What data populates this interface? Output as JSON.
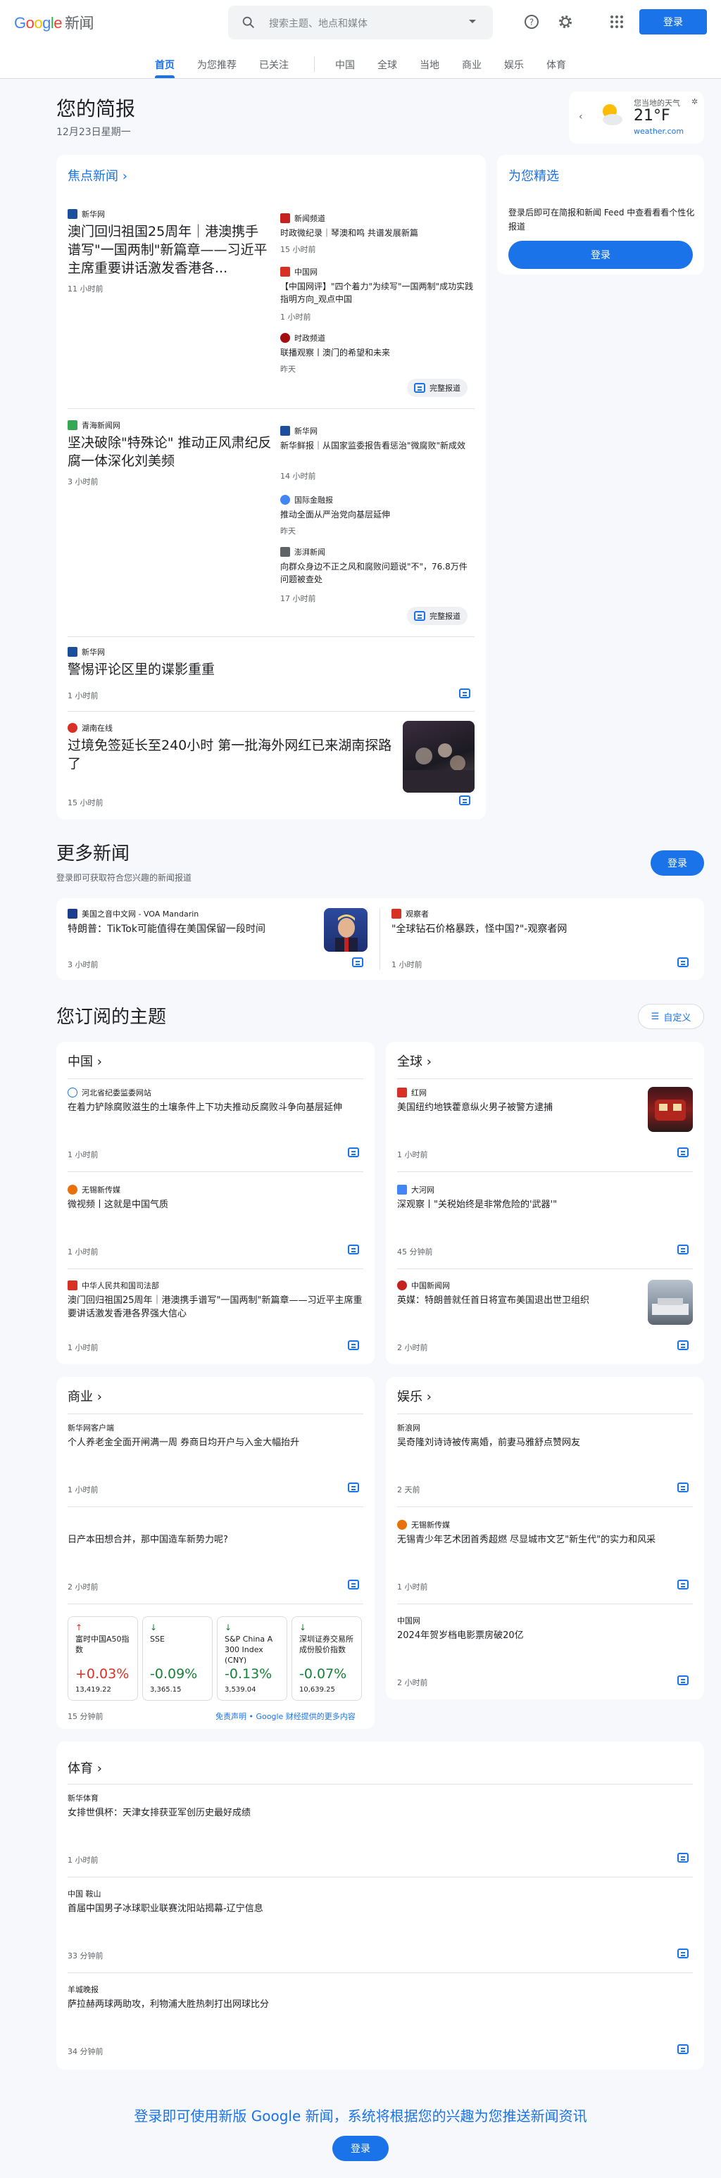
{
  "header": {
    "logo_google": "Google",
    "logo_news": "新闻",
    "search_placeholder": "搜索主题、地点和媒体",
    "signin": "登录"
  },
  "nav": [
    "首页",
    "为您推荐",
    "已关注",
    "中国",
    "全球",
    "当地",
    "商业",
    "娱乐",
    "体育"
  ],
  "briefing": {
    "title": "您的简报",
    "date": "12月23日星期一"
  },
  "weather": {
    "label": "您当地的天气",
    "temp": "21°F",
    "source": "weather.com"
  },
  "picks": {
    "title": "为您精选",
    "desc": "登录后即可在简报和新闻 Feed 中查看看看个性化报道",
    "button": "登录"
  },
  "top": {
    "title": "焦点新闻",
    "c1": {
      "source": "新华网",
      "headline": "澳门回归祖国25周年｜港澳携手谱写\"一国两制\"新篇章——习近平主席重要讲话激发香港各...",
      "time": "11 小时前",
      "side": [
        {
          "source": "新闻频道",
          "headline": "时政微纪录｜琴澳和鸣 共谱发展新篇",
          "time": "15 小时前"
        },
        {
          "source": "中国网",
          "headline": "【中国网评】\"四个着力\"为续写\"一国两制\"成功实践指明方向_观点中国",
          "time": "1 小时前"
        },
        {
          "source": "时政频道",
          "headline": "联播观察丨澳门的希望和未来",
          "time": "昨天"
        }
      ],
      "full": "完整报道"
    },
    "c2": {
      "source": "青海新闻网",
      "headline": "坚决破除\"特殊论\" 推动正风肃纪反腐一体深化刘美频",
      "time": "3 小时前",
      "side": [
        {
          "source": "新华网",
          "headline": "新华鲜报｜从国家监委报告看惩治\"微腐败\"新成效",
          "time": "14 小时前"
        },
        {
          "source": "国际金融报",
          "headline": "推动全面从严治党向基层延伸",
          "time": "昨天"
        },
        {
          "source": "澎湃新闻",
          "headline": "向群众身边不正之风和腐败问题说\"不\"，76.8万件问题被查处",
          "time": "17 小时前"
        }
      ],
      "full": "完整报道"
    },
    "s3": {
      "source": "新华网",
      "headline": "警惕评论区里的谍影重重",
      "time": "1 小时前"
    },
    "s4": {
      "source": "湖南在线",
      "headline": "过境免签延长至240小时 第一批海外网红已来湖南探路了",
      "time": "15 小时前"
    }
  },
  "more": {
    "title": "更多新闻",
    "subtitle": "登录即可获取符合您兴趣的新闻报道",
    "button": "登录",
    "items": [
      {
        "source": "美国之音中文网 - VOA Mandarin",
        "headline": "特朗普：TikTok可能值得在美国保留一段时间",
        "time": "3 小时前"
      },
      {
        "source": "观察者",
        "headline": "\"全球钻石价格暴跌，怪中国?\"-观察者网",
        "time": "1 小时前"
      }
    ]
  },
  "topics": {
    "title": "您订阅的主题",
    "customize": "自定义",
    "china": {
      "title": "中国",
      "items": [
        {
          "source": "河北省纪委监委网站",
          "headline": "在着力铲除腐败滋生的土壤条件上下功夫推动反腐败斗争向基层延伸",
          "time": "1 小时前"
        },
        {
          "source": "无锡新传媒",
          "headline": "微视频丨这就是中国气质",
          "time": "1 小时前"
        },
        {
          "source": "中华人民共和国司法部",
          "headline": "澳门回归祖国25周年｜港澳携手谱写\"一国两制\"新篇章——习近平主席重要讲话激发香港各界强大信心",
          "time": "1 小时前"
        }
      ]
    },
    "world": {
      "title": "全球",
      "items": [
        {
          "source": "红网",
          "headline": "美国纽约地铁藿意纵火男子被警方逮捕",
          "time": "1 小时前"
        },
        {
          "source": "大河网",
          "headline": "深观察丨\"关税始终是非常危险的'武器'\"",
          "time": "45 分钟前"
        },
        {
          "source": "中国新闻网",
          "headline": "英媒：特朗普就任首日将宣布美国退出世卫组织",
          "time": "2 小时前"
        }
      ]
    },
    "business": {
      "title": "商业",
      "items": [
        {
          "source": "新华网客户端",
          "headline": "个人养老金全面开闸满一周 券商日均开户与入金大幅抬升",
          "time": "1 小时前"
        },
        {
          "source": "",
          "headline": "日产本田想合并，那中国造车新势力呢?",
          "time": "2 小时前"
        }
      ],
      "stocks": [
        {
          "name": "富时中国A50指数",
          "change": "+0.03%",
          "price": "13,419.22",
          "up": true
        },
        {
          "name": "SSE",
          "change": "-0.09%",
          "price": "3,365.15",
          "up": false
        },
        {
          "name": "S&P China A 300 Index (CNY)",
          "change": "-0.13%",
          "price": "3,539.04",
          "up": false
        },
        {
          "name": "深圳证券交易所成份股价指数",
          "change": "-0.07%",
          "price": "10,639.25",
          "up": false
        }
      ],
      "stock_time": "15 分钟前",
      "disclaimer": "免责声明",
      "more_link": "Google 财经提供的更多内容"
    },
    "ent": {
      "title": "娱乐",
      "items": [
        {
          "source": "新浪网",
          "headline": "吴奇隆刘诗诗被传离婚，前妻马雅舒点赞网友",
          "time": "2 天前"
        },
        {
          "source": "无锡新传媒",
          "headline": "无锡青少年艺术团首秀超燃 尽显城市文艺\"新生代\"的实力和风采",
          "time": "1 小时前"
        },
        {
          "source": "中国网",
          "headline": "2024年贺岁档电影票房破20亿",
          "time": "2 小时前"
        }
      ]
    },
    "sports": {
      "title": "体育",
      "items": [
        {
          "source": "新华体育",
          "headline": "女排世俱杯：天津女排获亚军创历史最好成绩",
          "time": "1 小时前"
        },
        {
          "source": "中国 鞍山",
          "headline": "首届中国男子冰球职业联赛沈阳站揭幕-辽宁信息",
          "time": "33 分钟前"
        },
        {
          "source": "羊城晚报",
          "headline": "萨拉赫两球两助攻，利物浦大胜热刺打出网球比分",
          "time": "34 分钟前"
        }
      ]
    }
  },
  "footer": {
    "text": "登录即可使用新版 Google 新闻，系统将根据您的兴趣为您推送新闻资讯",
    "button": "登录"
  },
  "colors": {
    "accent": "#1a73e8",
    "up": "#d93025",
    "down": "#188038"
  }
}
